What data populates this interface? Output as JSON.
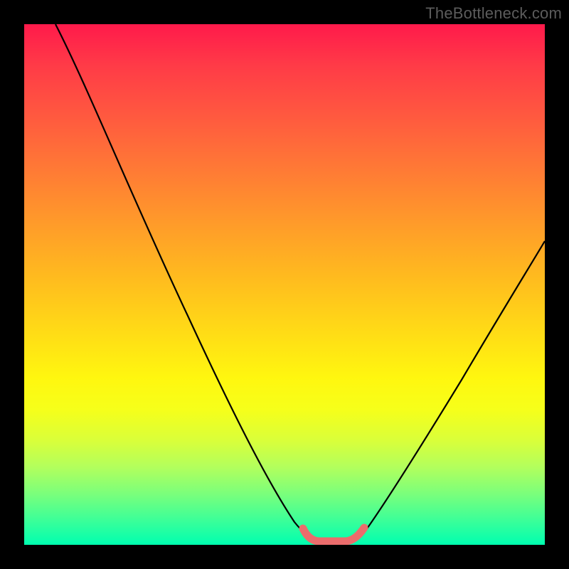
{
  "watermark": {
    "text": "TheBottleneck.com"
  },
  "colors": {
    "frame": "#000000",
    "curve_stroke": "#000000",
    "trough_stroke": "#eb6c6c",
    "gradient_top": "#ff1a4b",
    "gradient_bottom": "#00ffb0",
    "watermark_text": "#5c5c5c"
  },
  "chart_data": {
    "type": "line",
    "title": "",
    "xlabel": "",
    "ylabel": "",
    "xlim": [
      0,
      100
    ],
    "ylim": [
      0,
      100
    ],
    "grid": false,
    "legend": false,
    "annotations": [
      "TheBottleneck.com"
    ],
    "description": "Single V-shaped bottleneck curve on a vertical red→green gradient. The curve drops from top-left, reaches a flat minimum (highlighted by a coral mark) around x≈56–65, then rises toward the right edge at mid-height.",
    "trough_range_x": [
      56,
      65
    ],
    "series": [
      {
        "name": "bottleneck-curve",
        "x": [
          6,
          15,
          25,
          35,
          42,
          48,
          53,
          56,
          58,
          60,
          62,
          64,
          67,
          72,
          80,
          90,
          100
        ],
        "y": [
          100,
          82,
          62,
          44,
          33,
          22,
          12,
          5,
          2,
          1,
          1,
          2,
          5,
          12,
          25,
          40,
          55
        ]
      }
    ]
  }
}
